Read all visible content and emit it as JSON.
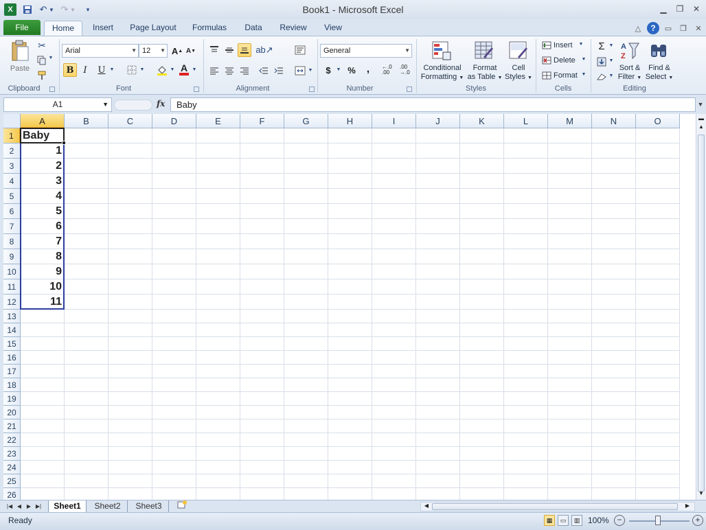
{
  "window": {
    "title": "Book1  -  Microsoft Excel",
    "app_icon": "X"
  },
  "ribbon_tabs": {
    "file": "File",
    "items": [
      "Home",
      "Insert",
      "Page Layout",
      "Formulas",
      "Data",
      "Review",
      "View"
    ],
    "active": "Home"
  },
  "ribbon": {
    "clipboard": {
      "group_label": "Clipboard",
      "paste_label": "Paste"
    },
    "font": {
      "group_label": "Font",
      "font_name": "Arial",
      "font_size": "12",
      "bold": "B",
      "italic": "I",
      "underline": "U",
      "grow": "A",
      "shrink": "A",
      "font_color_letter": "A",
      "font_color": "#e02020",
      "fill_color": "#f5e21c"
    },
    "alignment": {
      "group_label": "Alignment"
    },
    "number": {
      "group_label": "Number",
      "format": "General",
      "currency": "$",
      "percent": "%",
      "comma": ",",
      "inc_decimal": "←.0 .00",
      "dec_decimal": ".00 →.0"
    },
    "styles": {
      "group_label": "Styles",
      "conditional_formatting_1": "Conditional",
      "conditional_formatting_2": "Formatting",
      "format_as_table_1": "Format",
      "format_as_table_2": "as Table",
      "cell_styles_1": "Cell",
      "cell_styles_2": "Styles"
    },
    "cells": {
      "group_label": "Cells",
      "insert": "Insert",
      "delete": "Delete",
      "format": "Format"
    },
    "editing": {
      "group_label": "Editing",
      "autosum": "Σ",
      "sort_filter_1": "Sort &",
      "sort_filter_2": "Filter",
      "find_select_1": "Find &",
      "find_select_2": "Select"
    }
  },
  "formula_bar": {
    "name_box": "A1",
    "fx": "fx",
    "formula": "Baby"
  },
  "grid": {
    "columns": [
      "A",
      "B",
      "C",
      "D",
      "E",
      "F",
      "G",
      "H",
      "I",
      "J",
      "K",
      "L",
      "M",
      "N",
      "O"
    ],
    "rows": [
      "1",
      "2",
      "3",
      "4",
      "5",
      "6",
      "7",
      "8",
      "9",
      "10",
      "11",
      "12",
      "13",
      "14",
      "15",
      "16",
      "17",
      "18",
      "19",
      "20",
      "21",
      "22",
      "23",
      "24",
      "25",
      "26"
    ],
    "cells": {
      "A1": "Baby",
      "A2": "1",
      "A3": "2",
      "A4": "3",
      "A5": "4",
      "A6": "5",
      "A7": "6",
      "A8": "7",
      "A9": "8",
      "A10": "9",
      "A11": "10",
      "A12": "11"
    },
    "selected_column": "A",
    "selected_row": "1"
  },
  "sheets": {
    "tabs": [
      "Sheet1",
      "Sheet2",
      "Sheet3"
    ],
    "active": "Sheet1"
  },
  "statusbar": {
    "status": "Ready",
    "zoom": "100%",
    "zoom_minus": "−",
    "zoom_plus": "+"
  }
}
